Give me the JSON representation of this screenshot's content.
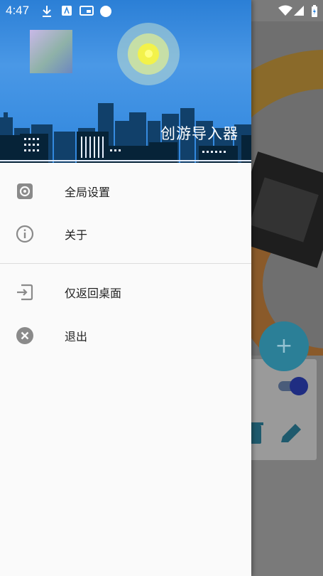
{
  "status_bar": {
    "time": "4:47",
    "left_icons": [
      "download-icon",
      "a-box-icon",
      "cast-icon",
      "circle-icon"
    ],
    "right_icons": [
      "wifi-icon",
      "signal-icon",
      "battery-charging-icon"
    ]
  },
  "drawer": {
    "header_title": "创游导入器",
    "menu_primary": [
      {
        "label": "全局设置",
        "icon": "settings-gear-icon"
      },
      {
        "label": "关于",
        "icon": "info-icon"
      }
    ],
    "menu_secondary": [
      {
        "label": "仅返回桌面",
        "icon": "exit-to-app-icon"
      },
      {
        "label": "退出",
        "icon": "close-circle-icon"
      }
    ]
  },
  "background_app": {
    "fab_symbol": "+",
    "card_icons": [
      "delete-icon",
      "edit-icon"
    ]
  },
  "colors": {
    "header_blue": "#2f86dd",
    "scrim": "#7a7a7a",
    "fab": "#2b7f97",
    "drawer_bg": "#fafafa"
  }
}
